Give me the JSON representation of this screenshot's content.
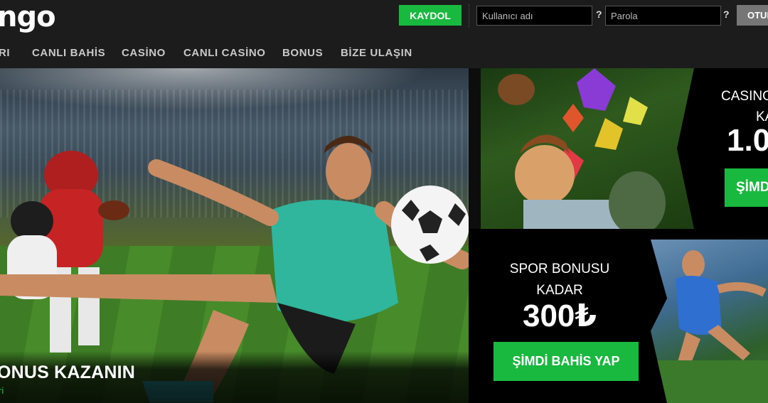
{
  "brand": {
    "logo_text": "ngo"
  },
  "header": {
    "register_label": "KAYDOL",
    "username_placeholder": "Kullanıcı adı",
    "password_placeholder": "Parola",
    "help_mark": "?",
    "login_label": "OTUR"
  },
  "nav": {
    "items": [
      {
        "label": "RI"
      },
      {
        "label": "CANLI BAHİS"
      },
      {
        "label": "CASİNO"
      },
      {
        "label": "CANLI CASİNO"
      },
      {
        "label": "BONUS"
      },
      {
        "label": "BİZE ULAŞIN"
      }
    ]
  },
  "hero": {
    "title": "ONUS KAZANIN",
    "subtitle": "ri"
  },
  "casino_banner": {
    "line1": "CASINO",
    "line2": "KA",
    "amount": "1.0",
    "cta": "ŞİMD"
  },
  "sport_banner": {
    "line1": "SPOR BONUSU",
    "line2": "KADAR",
    "amount": "300₺",
    "cta": "ŞİMDİ BAHİS YAP"
  },
  "colors": {
    "accent_green": "#19b93f",
    "header_bg": "#1c1c1c",
    "login_button": "#767676"
  }
}
